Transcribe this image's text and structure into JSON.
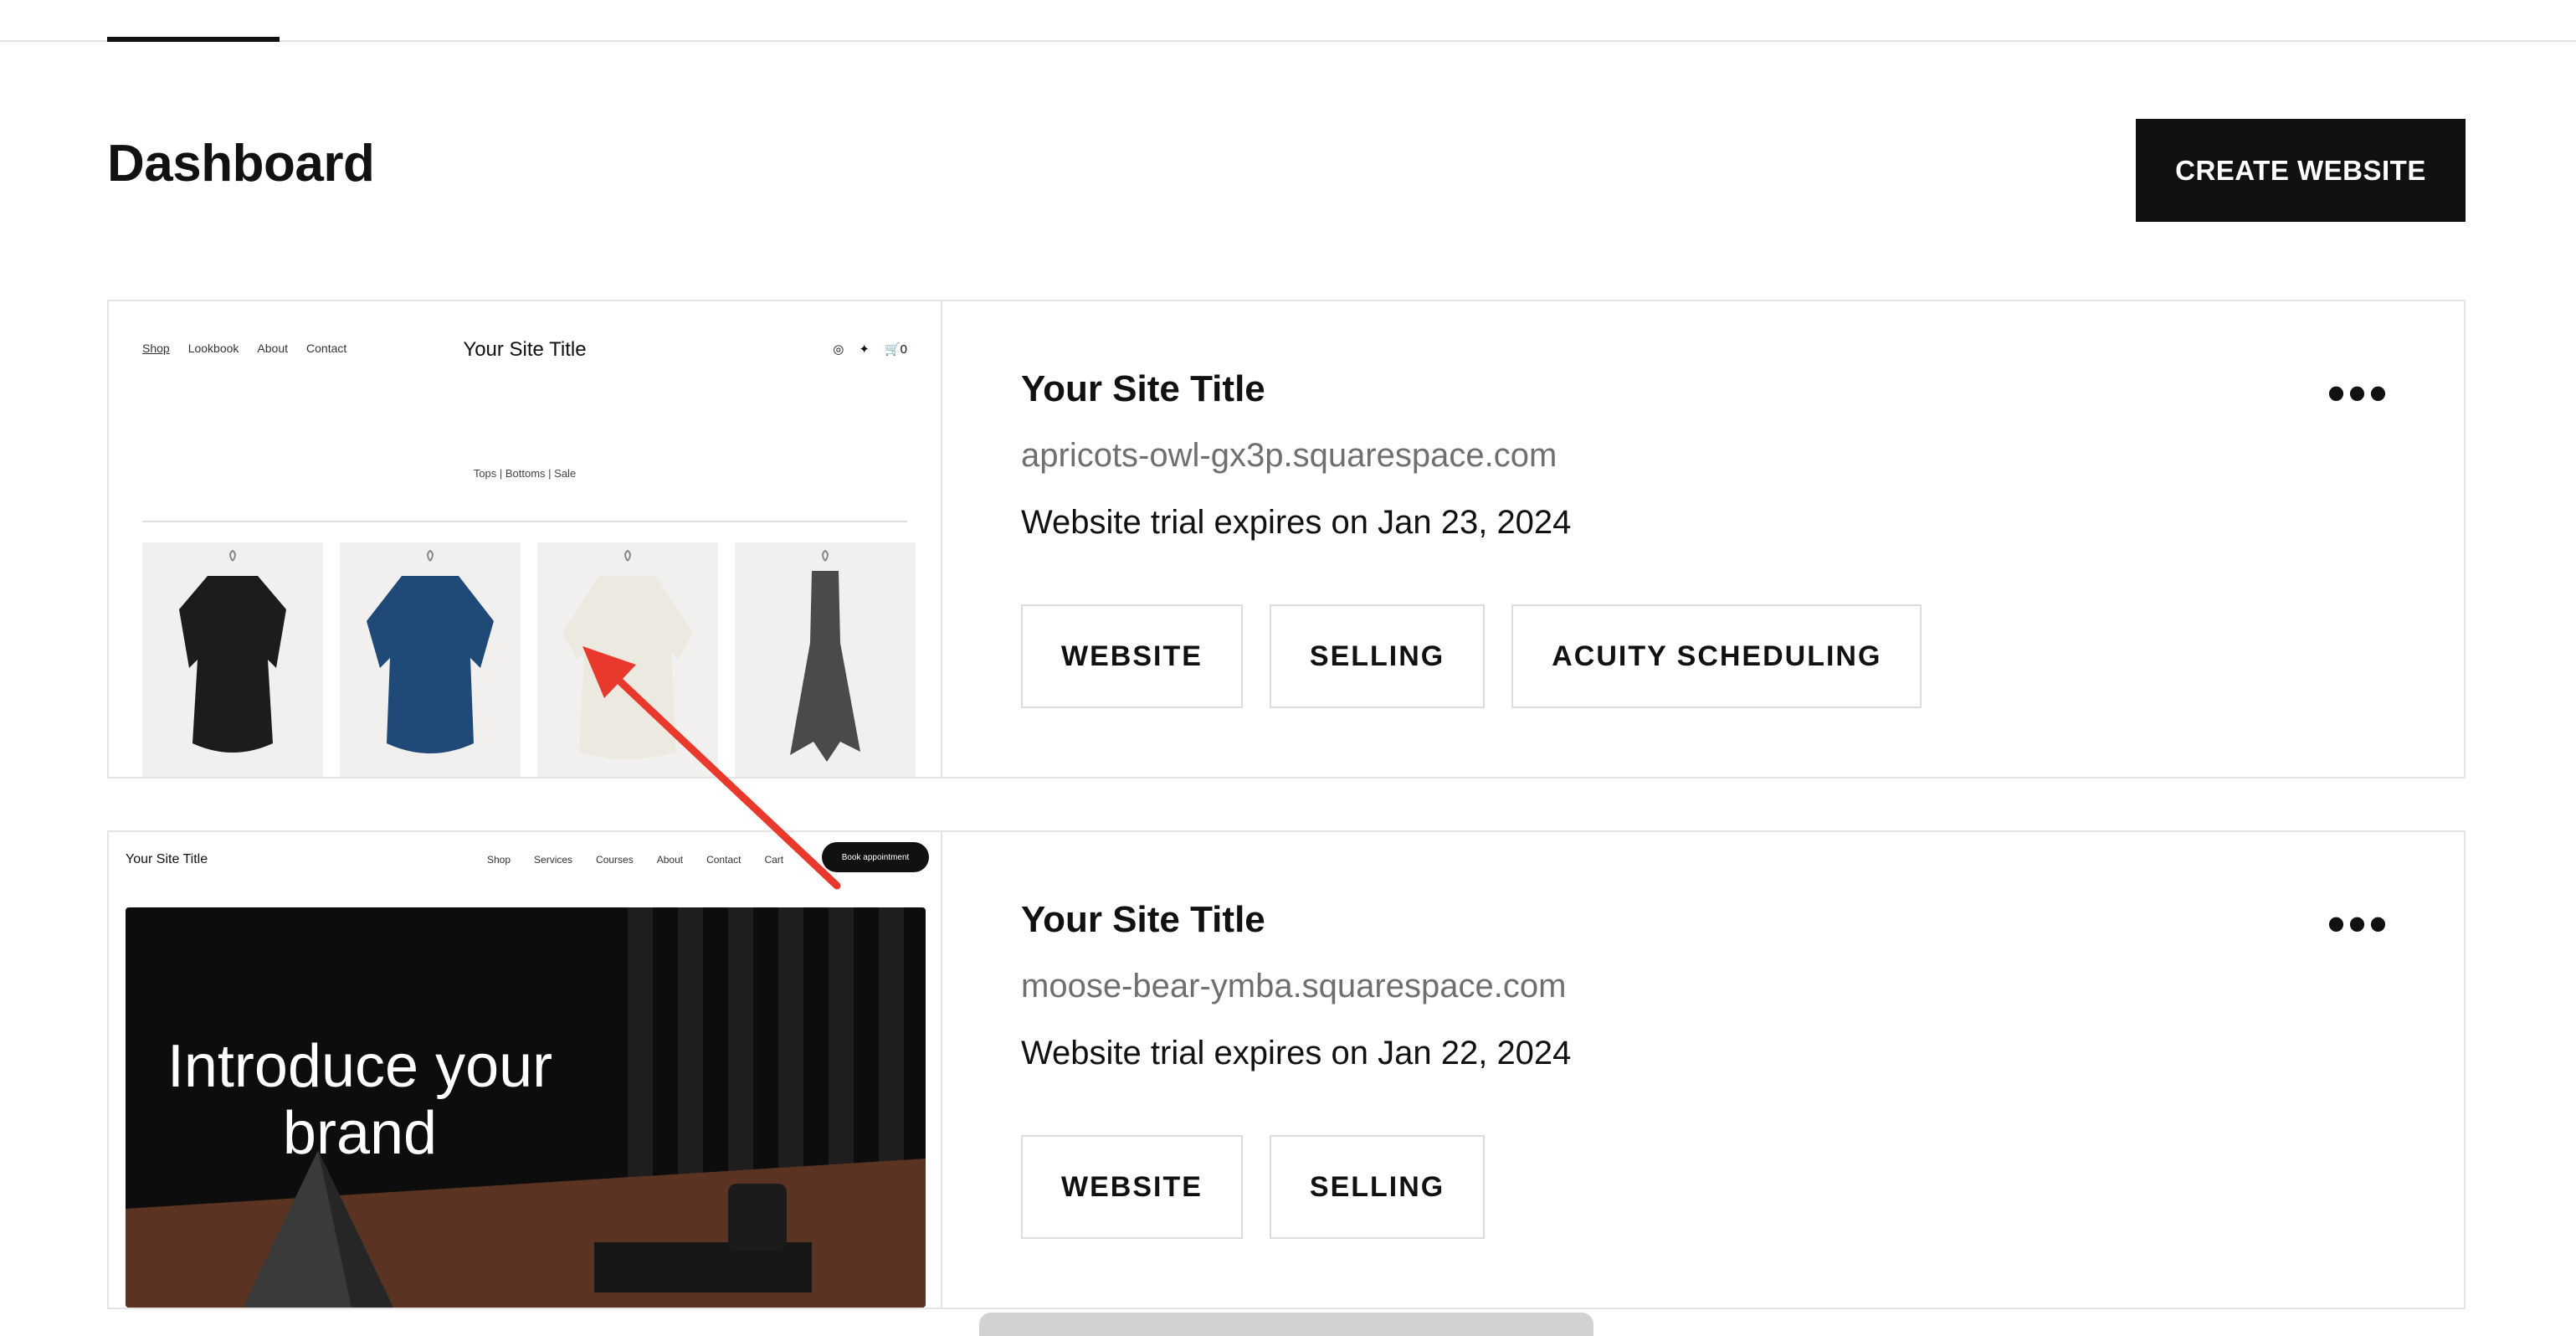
{
  "header": {
    "page_title": "Dashboard",
    "create_label": "CREATE WEBSITE"
  },
  "sites": [
    {
      "title": "Your Site Title",
      "url": "apricots-owl-gx3p.squarespace.com",
      "trial": "Website trial expires on Jan 23, 2024",
      "tags": [
        "WEBSITE",
        "SELLING",
        "ACUITY SCHEDULING"
      ],
      "more_label": "•••",
      "preview": {
        "nav": [
          "Shop",
          "Lookbook",
          "About",
          "Contact"
        ],
        "site_title": "Your Site Title",
        "cart": "0",
        "subnav": "Tops  |  Bottoms  |  Sale"
      }
    },
    {
      "title": "Your Site Title",
      "url": "moose-bear-ymba.squarespace.com",
      "trial": "Website trial expires on Jan 22, 2024",
      "tags": [
        "WEBSITE",
        "SELLING"
      ],
      "more_label": "•••",
      "preview": {
        "site_title": "Your Site Title",
        "nav": [
          "Shop",
          "Services",
          "Courses",
          "About",
          "Contact",
          "Cart"
        ],
        "cta": "Book appointment",
        "hero": "Introduce your brand"
      }
    }
  ],
  "colors": {
    "primary": "#111111",
    "muted_text": "#6f6f6f",
    "border": "#e4e4e4",
    "annotation": "#e8392c"
  }
}
